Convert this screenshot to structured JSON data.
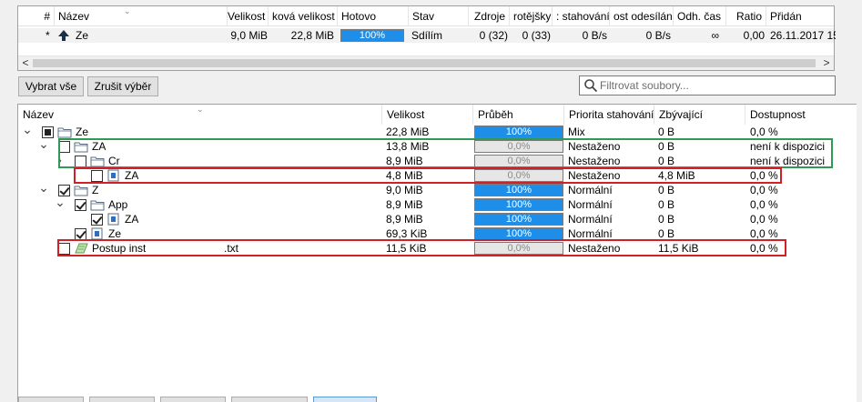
{
  "top_list": {
    "columns": [
      "#",
      "Název",
      "Velikost",
      "ková velikost",
      "Hotovo",
      "Stav",
      "Zdroje",
      "rotějšky",
      ": stahování",
      "ost odesílání",
      "Odh. čas",
      "Ratio",
      "Přidán"
    ],
    "row": {
      "queue": "*",
      "name": "Ze",
      "size": "9,0 MiB",
      "total_size": "22,8 MiB",
      "progress_text": "100%",
      "progress": 1.0,
      "status": "Sdílím",
      "seeds": "0 (32)",
      "peers": "0 (33)",
      "dl_speed": "0 B/s",
      "ul_speed": "0 B/s",
      "eta": "∞",
      "ratio": "0,00",
      "added": "26.11.2017 15:"
    },
    "scroll_left": "<",
    "scroll_right": ">"
  },
  "toolbar": {
    "select_all": "Vybrat vše",
    "deselect": "Zrušit výběr",
    "filter_placeholder": "Filtrovat soubory..."
  },
  "files": {
    "columns": [
      "Název",
      "Velikost",
      "Průběh",
      "Priorita stahování",
      "Zbývající",
      "Dostupnost"
    ],
    "rows": [
      {
        "name": "Ze",
        "size": "22,8 MiB",
        "progress_text": "100%",
        "progress": 1.0,
        "priority": "Mix",
        "remaining": "0 B",
        "availability": "0,0 %",
        "check": "partial",
        "type": "folder",
        "expander": "v"
      },
      {
        "name": "ZA",
        "size": "13,8 MiB",
        "progress_text": "0,0%",
        "progress": 0.0,
        "priority": "Nestaženo",
        "remaining": "0 B",
        "availability": "není k dispozici",
        "check": "unchecked",
        "type": "folder",
        "expander": "v"
      },
      {
        "name": "Cr",
        "size": "8,9 MiB",
        "progress_text": "0,0%",
        "progress": 0.0,
        "priority": "Nestaženo",
        "remaining": "0 B",
        "availability": "není k dispozici",
        "check": "unchecked",
        "type": "folder",
        "expander": ">"
      },
      {
        "name": "ZA",
        "size": "4,8 MiB",
        "progress_text": "0,0%",
        "progress": 0.0,
        "priority": "Nestaženo",
        "remaining": "4,8 MiB",
        "availability": "0,0 %",
        "check": "unchecked",
        "type": "file",
        "expander": ""
      },
      {
        "name": "Z",
        "size": "9,0 MiB",
        "progress_text": "100%",
        "progress": 1.0,
        "priority": "Normální",
        "remaining": "0 B",
        "availability": "0,0 %",
        "check": "checked",
        "type": "folder",
        "expander": "v"
      },
      {
        "name": "App",
        "size": "8,9 MiB",
        "progress_text": "100%",
        "progress": 1.0,
        "priority": "Normální",
        "remaining": "0 B",
        "availability": "0,0 %",
        "check": "checked",
        "type": "folder",
        "expander": "v"
      },
      {
        "name": "ZA",
        "size": "8,9 MiB",
        "progress_text": "100%",
        "progress": 1.0,
        "priority": "Normální",
        "remaining": "0 B",
        "availability": "0,0 %",
        "check": "checked",
        "type": "file",
        "expander": ""
      },
      {
        "name": "Ze",
        "size": "69,3 KiB",
        "progress_text": "100%",
        "progress": 1.0,
        "priority": "Normální",
        "remaining": "0 B",
        "availability": "0,0 %",
        "check": "checked",
        "type": "file",
        "expander": ""
      },
      {
        "name": "Postup inst",
        "name_suffix": ".txt",
        "size": "11,5 KiB",
        "progress_text": "0,0%",
        "progress": 0.0,
        "priority": "Nestaženo",
        "remaining": "11,5 KiB",
        "availability": "0,0 %",
        "check": "unchecked",
        "type": "text",
        "expander": ""
      }
    ]
  },
  "colors": {
    "progress_fill": "#1e8ee8",
    "highlight_green": "#2e9a55",
    "highlight_red": "#d31f26"
  }
}
